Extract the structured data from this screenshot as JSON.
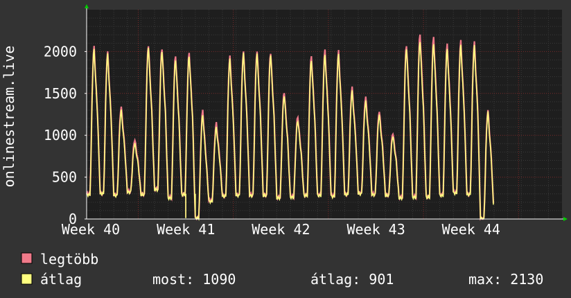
{
  "colors": {
    "background": "#333333",
    "plot_background": "#1e1e1e",
    "grid_minor": "#3a3a3a",
    "grid_major": "#7a2a2a",
    "axis": "#ffffff",
    "series_max": "#f07a8a",
    "series_avg": "#ffff80"
  },
  "chart_data": {
    "type": "line",
    "ylabel": "onlinestream.live",
    "ylim": [
      0,
      2500
    ],
    "yticks": [
      0,
      500,
      1000,
      1500,
      2000
    ],
    "xlim": [
      0,
      35
    ],
    "xticks": [
      {
        "value": 0.3,
        "label": "Week 40"
      },
      {
        "value": 7.3,
        "label": "Week 41"
      },
      {
        "value": 14.3,
        "label": "Week 42"
      },
      {
        "value": 21.3,
        "label": "Week 43"
      },
      {
        "value": 28.3,
        "label": "Week 44"
      }
    ],
    "x_unit": "days",
    "grid": true,
    "series": [
      {
        "name": "legtöbb",
        "color": "#f07a8a",
        "daily_peak": [
          2050,
          1990,
          1340,
          950,
          2080,
          2040,
          1950,
          1980,
          1290,
          1140,
          1940,
          2000,
          2010,
          1990,
          1520,
          1220,
          1940,
          2010,
          2000,
          1570,
          1460,
          1290,
          1030,
          2080,
          2210,
          2170,
          2080,
          2120,
          2110,
          1300
        ],
        "daily_low": [
          300,
          310,
          290,
          330,
          300,
          360,
          260,
          300,
          10,
          220,
          280,
          290,
          290,
          290,
          260,
          270,
          290,
          290,
          280,
          300,
          310,
          300,
          290,
          260,
          270,
          270,
          290,
          320,
          300,
          0
        ],
        "gaps": [
          {
            "x": 7.3,
            "value": 20
          },
          {
            "x": 8.0,
            "value": 120
          }
        ]
      },
      {
        "name": "átlag",
        "color": "#ffff80",
        "daily_peak": [
          2020,
          1960,
          1290,
          900,
          2050,
          2010,
          1910,
          1950,
          1240,
          1090,
          1900,
          1970,
          1970,
          1960,
          1480,
          1180,
          1900,
          1960,
          1960,
          1520,
          1400,
          1240,
          990,
          2040,
          2130,
          2100,
          2030,
          2070,
          2060,
          1270
        ],
        "daily_low": [
          290,
          300,
          280,
          320,
          290,
          350,
          250,
          290,
          10,
          210,
          270,
          280,
          280,
          280,
          250,
          260,
          280,
          280,
          270,
          290,
          300,
          290,
          280,
          250,
          260,
          260,
          280,
          310,
          290,
          0
        ],
        "gaps": [
          {
            "x": 7.3,
            "value": 10
          },
          {
            "x": 8.0,
            "value": 80
          }
        ]
      }
    ],
    "legend": [
      {
        "label": "legtöbb",
        "color": "#f07a8a"
      },
      {
        "label": "átlag",
        "color": "#ffff80"
      }
    ],
    "summary": {
      "now": "most: 1090",
      "avg": "átlag: 901",
      "max": "max: 2130"
    }
  }
}
